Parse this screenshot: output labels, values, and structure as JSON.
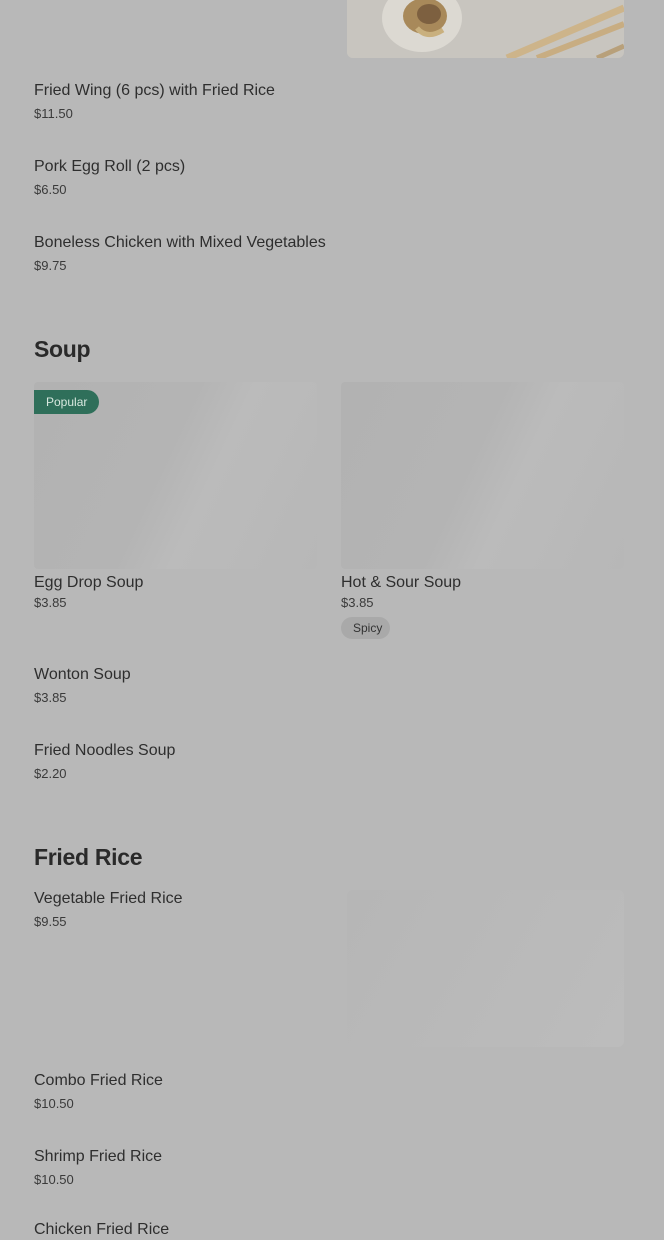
{
  "menu": {
    "appetizers": {
      "items": [
        {
          "name": "Fried Wing (6 pcs) with Fried Rice",
          "price": "$11.50"
        },
        {
          "name": "Pork Egg Roll (2 pcs)",
          "price": "$6.50"
        },
        {
          "name": "Boneless Chicken with Mixed Vegetables",
          "price": "$9.75"
        }
      ]
    },
    "soup": {
      "title": "Soup",
      "cards": [
        {
          "name": "Egg Drop Soup",
          "price": "$3.85",
          "badge": "Popular"
        },
        {
          "name": "Hot & Sour Soup",
          "price": "$3.85",
          "tag": "Spicy"
        }
      ],
      "items": [
        {
          "name": "Wonton Soup",
          "price": "$3.85"
        },
        {
          "name": "Fried Noodles Soup",
          "price": "$2.20"
        }
      ]
    },
    "fried_rice": {
      "title": "Fried Rice",
      "items": [
        {
          "name": "Vegetable Fried Rice",
          "price": "$9.55"
        },
        {
          "name": "Combo Fried Rice",
          "price": "$10.50"
        },
        {
          "name": "Shrimp Fried Rice",
          "price": "$10.50"
        },
        {
          "name": "Chicken Fried Rice",
          "price": ""
        }
      ]
    }
  }
}
